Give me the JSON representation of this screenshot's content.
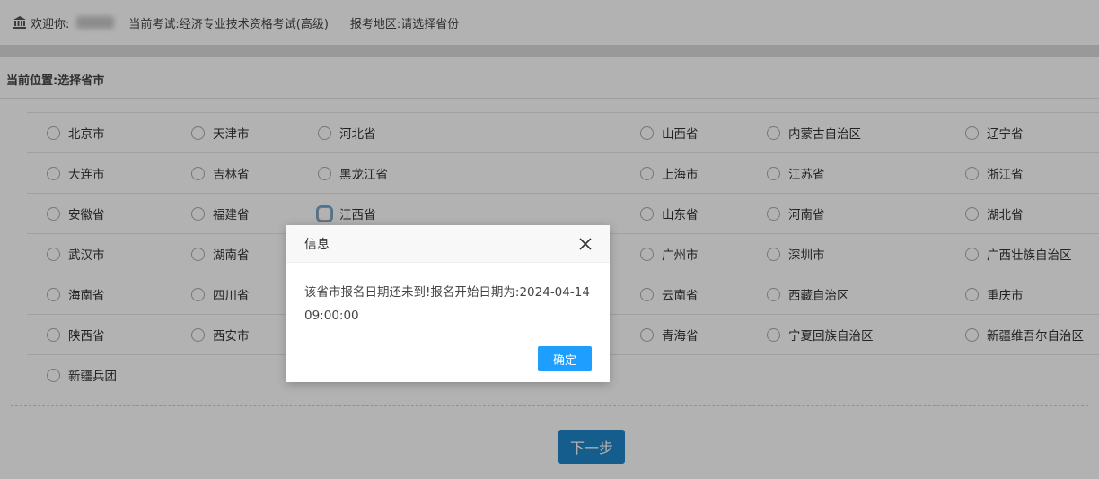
{
  "header": {
    "welcome_label": "欢迎你:",
    "exam_label": "当前考试:经济专业技术资格考试(高级)",
    "region_label": "报考地区:请选择省份"
  },
  "location": {
    "label": "当前位置:选择省市"
  },
  "provinces": [
    [
      "北京市",
      "天津市",
      "河北省",
      "山西省",
      "内蒙古自治区",
      "辽宁省"
    ],
    [
      "大连市",
      "吉林省",
      "黑龙江省",
      "上海市",
      "江苏省",
      "浙江省"
    ],
    [
      "安徽省",
      "福建省",
      "江西省",
      "山东省",
      "河南省",
      "湖北省"
    ],
    [
      "武汉市",
      "湖南省",
      "",
      "广州市",
      "深圳市",
      "广西壮族自治区"
    ],
    [
      "海南省",
      "四川省",
      "",
      "云南省",
      "西藏自治区",
      "重庆市"
    ],
    [
      "陕西省",
      "西安市",
      "",
      "青海省",
      "宁夏回族自治区",
      "新疆维吾尔自治区"
    ],
    [
      "新疆兵团",
      "",
      "",
      "",
      "",
      ""
    ]
  ],
  "next_button": "下一步",
  "dialog": {
    "title": "信息",
    "message": "该省市报名日期还未到!报名开始日期为:2024-04-14 09:00:00",
    "ok_label": "确定"
  },
  "icons": {
    "bank": "bank-icon",
    "close": "close-icon"
  },
  "colors": {
    "primary": "#1e9fff",
    "next_button": "#1f86c9"
  }
}
